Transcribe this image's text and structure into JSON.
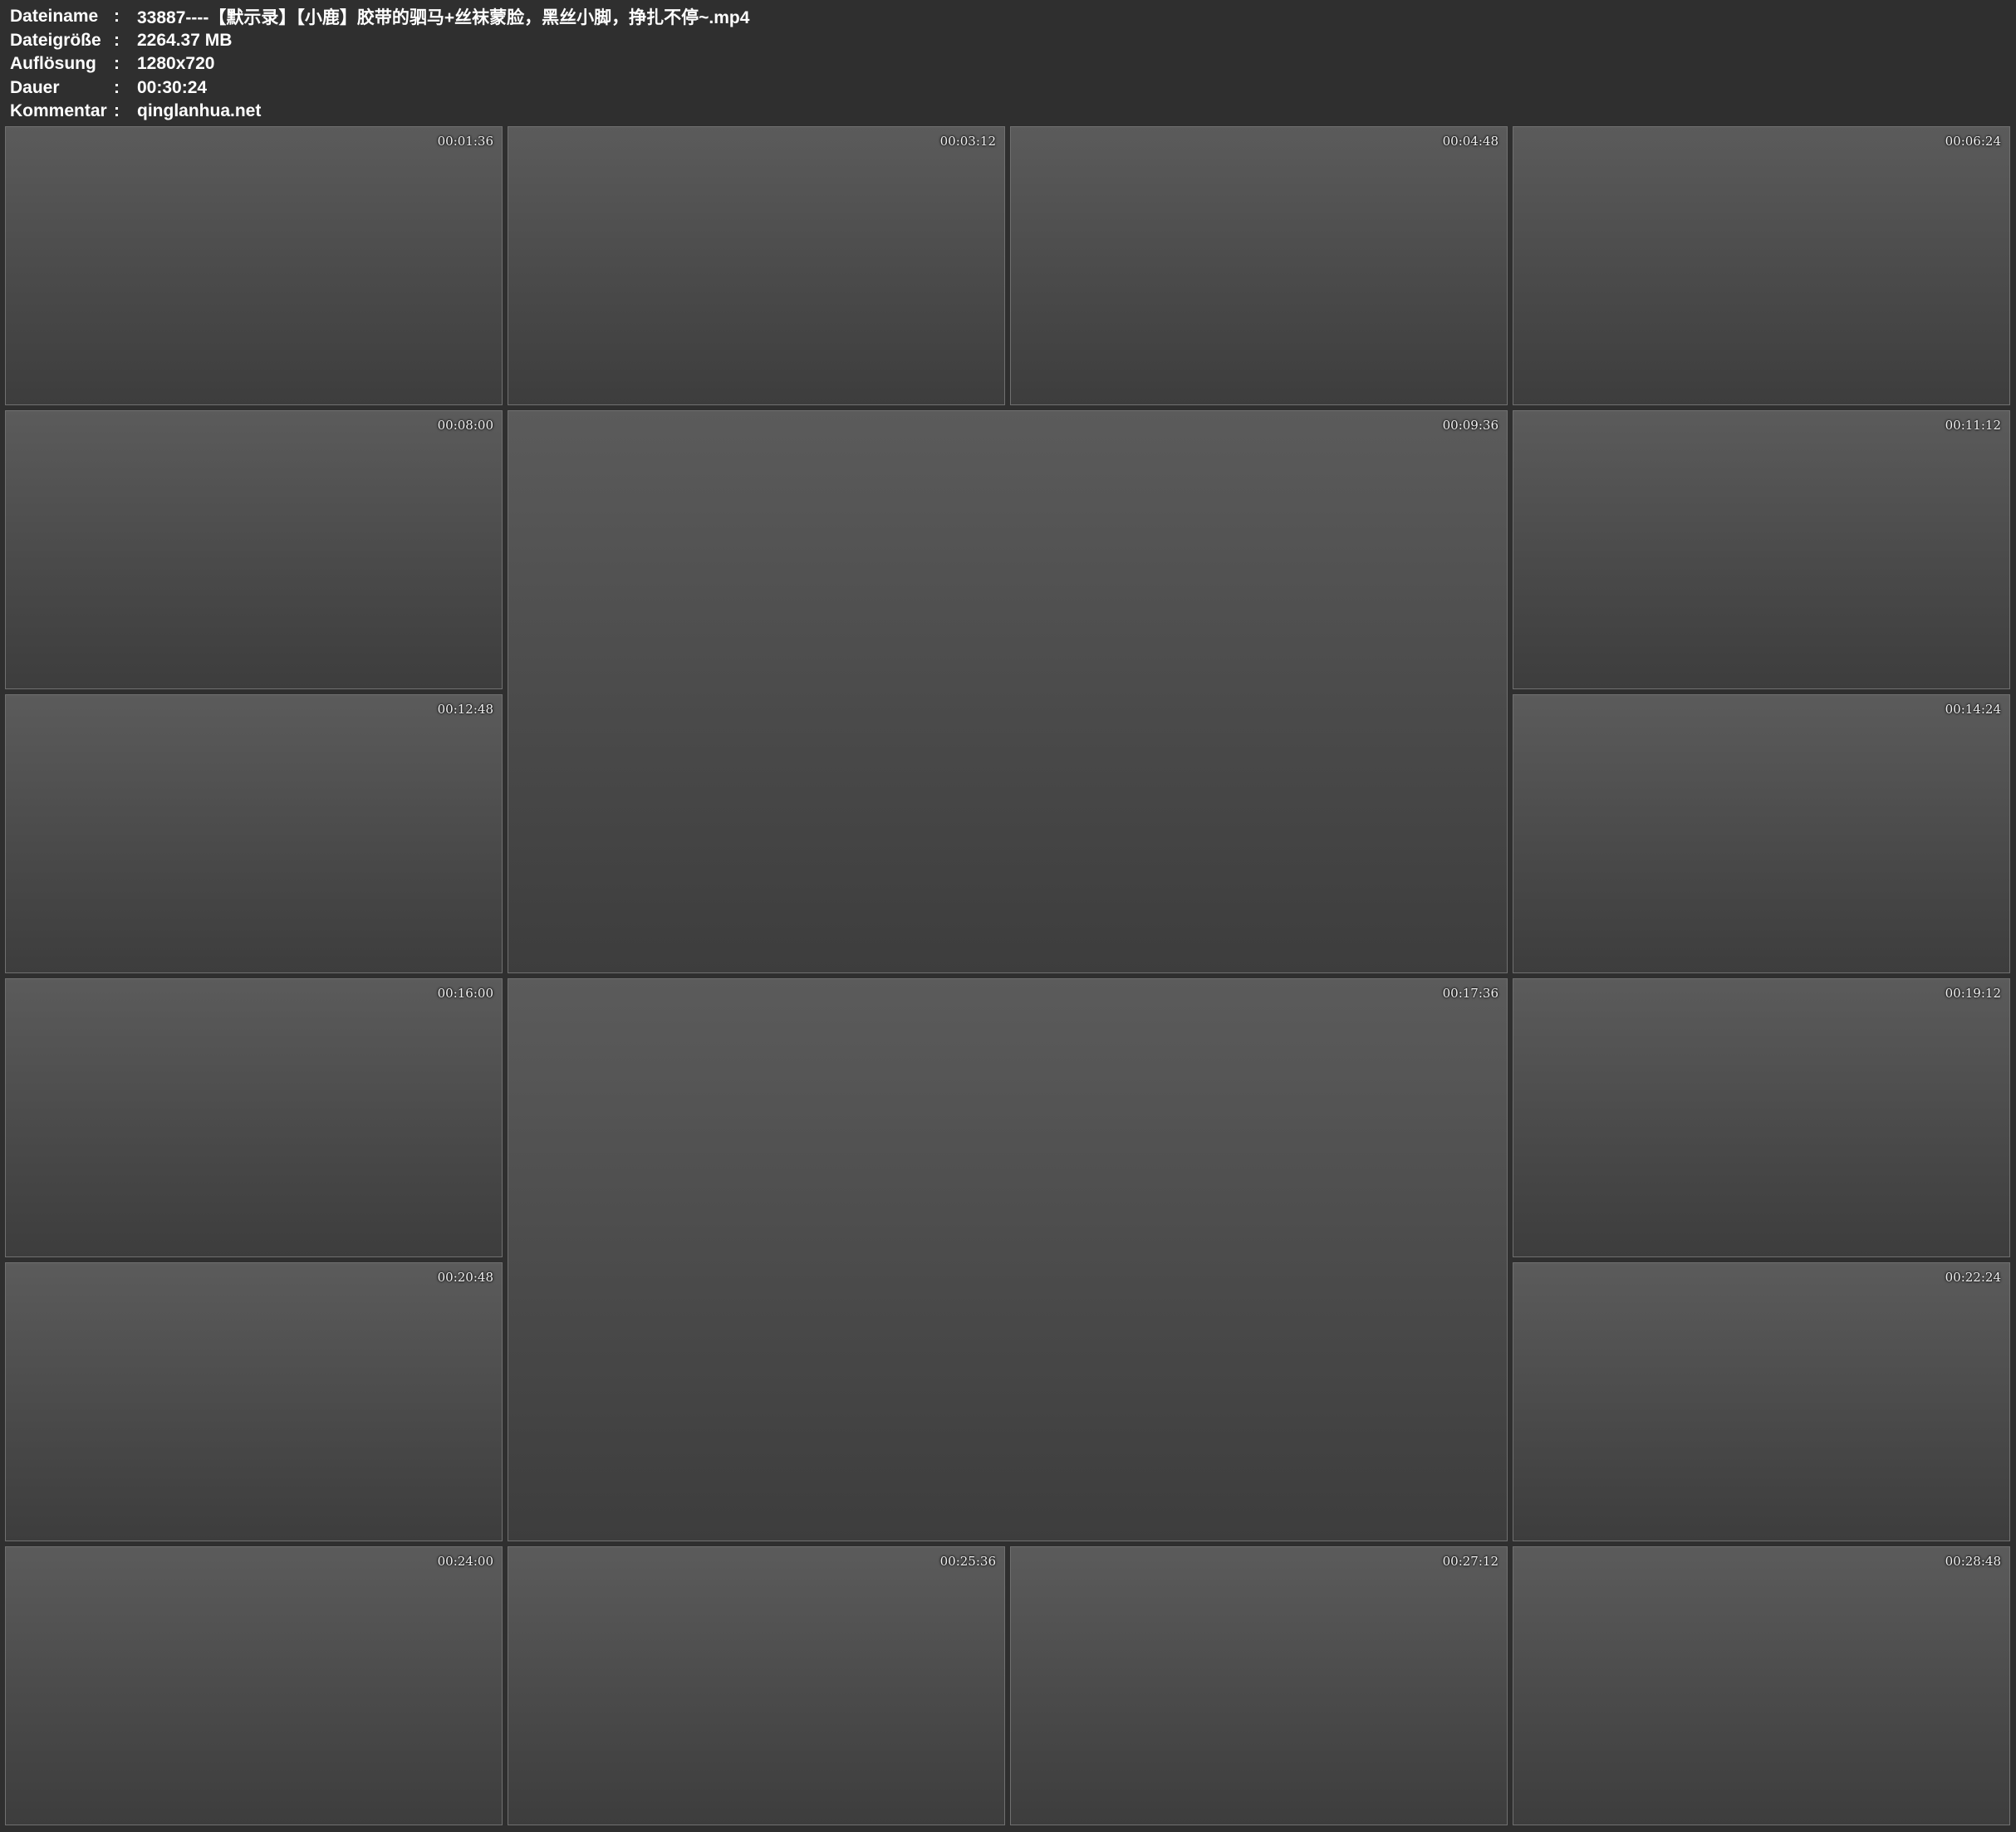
{
  "header": {
    "rows": [
      {
        "label": "Dateiname",
        "sep": ":",
        "value": "33887----【默示录】【小鹿】胶带的驷马+丝袜蒙脸，黑丝小脚，挣扎不停~.mp4"
      },
      {
        "label": "Dateigröße",
        "sep": ":",
        "value": "2264.37 MB"
      },
      {
        "label": "Auflösung",
        "sep": ":",
        "value": "1280x720"
      },
      {
        "label": "Dauer",
        "sep": ":",
        "value": "00:30:24"
      },
      {
        "label": "Kommentar",
        "sep": ":",
        "value": "qinglanhua.net"
      }
    ]
  },
  "thumbnails": [
    {
      "time": "00:01:36"
    },
    {
      "time": "00:03:12"
    },
    {
      "time": "00:04:48"
    },
    {
      "time": "00:06:24"
    },
    {
      "time": "00:08:00"
    },
    {
      "time": "00:09:36"
    },
    {
      "time": "00:11:12"
    },
    {
      "time": "00:12:48"
    },
    {
      "time": "00:14:24"
    },
    {
      "time": "00:16:00"
    },
    {
      "time": "00:17:36"
    },
    {
      "time": "00:19:12"
    },
    {
      "time": "00:20:48"
    },
    {
      "time": "00:22:24"
    },
    {
      "time": "00:24:00"
    },
    {
      "time": "00:25:36"
    },
    {
      "time": "00:27:12"
    },
    {
      "time": "00:28:48"
    }
  ]
}
